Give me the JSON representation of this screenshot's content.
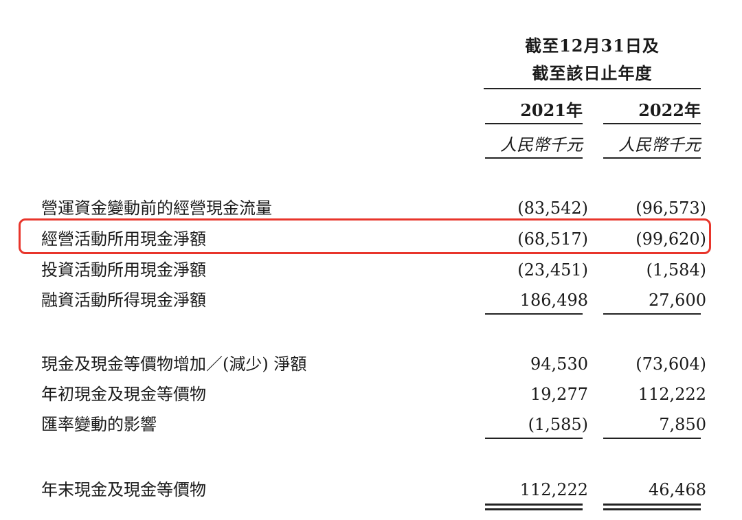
{
  "header": {
    "line1": "截至12月31日及",
    "line2": "截至該日止年度",
    "col_2021": "2021年",
    "col_2022": "2022年",
    "unit": "人民幣千元"
  },
  "rows": [
    {
      "label": "營運資金變動前的經營現金流量",
      "v2021": "(83,542)",
      "v2022": "(96,573)"
    },
    {
      "label": "經營活動所用現金淨額",
      "v2021": "(68,517)",
      "v2022": "(99,620)"
    },
    {
      "label": "投資活動所用現金淨額",
      "v2021": "(23,451)",
      "v2022": "(1,584)"
    },
    {
      "label": "融資活動所得現金淨額",
      "v2021": "186,498",
      "v2022": "27,600"
    },
    {
      "label": "現金及現金等價物增加／(減少) 淨額",
      "v2021": "94,530",
      "v2022": "(73,604)"
    },
    {
      "label": "年初現金及現金等價物",
      "v2021": "19,277",
      "v2022": "112,222"
    },
    {
      "label": "匯率變動的影響",
      "v2021": "(1,585)",
      "v2022": "7,850"
    },
    {
      "label": "年末現金及現金等價物",
      "v2021": "112,222",
      "v2022": "46,468"
    }
  ],
  "colors": {
    "highlight": "#e8352b",
    "text": "#1a1a1a"
  }
}
